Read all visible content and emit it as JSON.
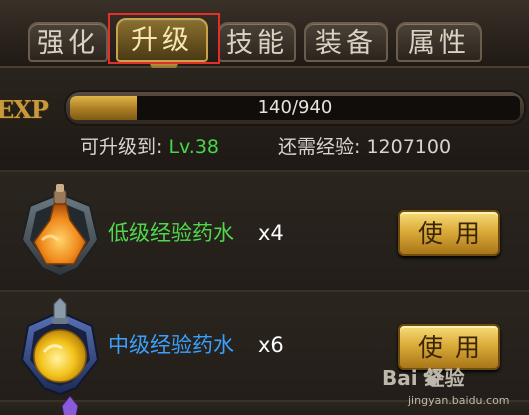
{
  "tabs": [
    {
      "label": "强化",
      "active": false
    },
    {
      "label": "升级",
      "active": true
    },
    {
      "label": "技能",
      "active": false
    },
    {
      "label": "装备",
      "active": false
    },
    {
      "label": "属性",
      "active": false
    }
  ],
  "exp": {
    "label": "EXP",
    "current": 140,
    "max": 940,
    "text": "140/940",
    "fill_fraction": 0.149
  },
  "level": {
    "prefix": "可升级到: ",
    "value": "Lv.38"
  },
  "need": {
    "text": "还需经验: 1207100"
  },
  "items": [
    {
      "name": "低级经验药水",
      "qty": "x4",
      "button": "使用",
      "icon": "orange-potion-icon",
      "name_color": "#4fd84c"
    },
    {
      "name": "中级经验药水",
      "qty": "x6",
      "button": "使用",
      "icon": "yellow-potion-icon",
      "name_color": "#3aa0ff"
    }
  ],
  "watermark": {
    "main": "Bai  经验",
    "sub": "jingyan.baidu.com"
  },
  "colors": {
    "highlight": "#e0302b",
    "exp_fill": "#c9962e",
    "level_green": "#46d64a",
    "button_gold": "#dcac3a"
  }
}
